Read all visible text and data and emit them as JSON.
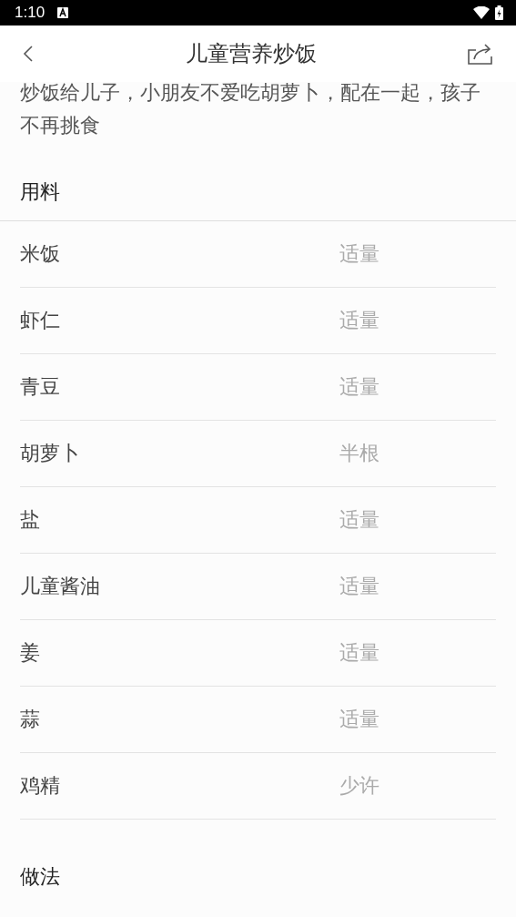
{
  "status_bar": {
    "time": "1:10"
  },
  "header": {
    "title": "儿童营养炒饭"
  },
  "description": "炒饭给儿子，小朋友不爱吃胡萝卜，配在一起，孩子不再挑食",
  "ingredients": {
    "heading": "用料",
    "items": [
      {
        "name": "米饭",
        "amount": "适量"
      },
      {
        "name": "虾仁",
        "amount": "适量"
      },
      {
        "name": "青豆",
        "amount": "适量"
      },
      {
        "name": "胡萝卜",
        "amount": "半根"
      },
      {
        "name": "盐",
        "amount": "适量"
      },
      {
        "name": "儿童酱油",
        "amount": "适量"
      },
      {
        "name": "姜",
        "amount": "适量"
      },
      {
        "name": "蒜",
        "amount": "适量"
      },
      {
        "name": "鸡精",
        "amount": "少许"
      }
    ]
  },
  "steps": {
    "heading": "做法"
  }
}
